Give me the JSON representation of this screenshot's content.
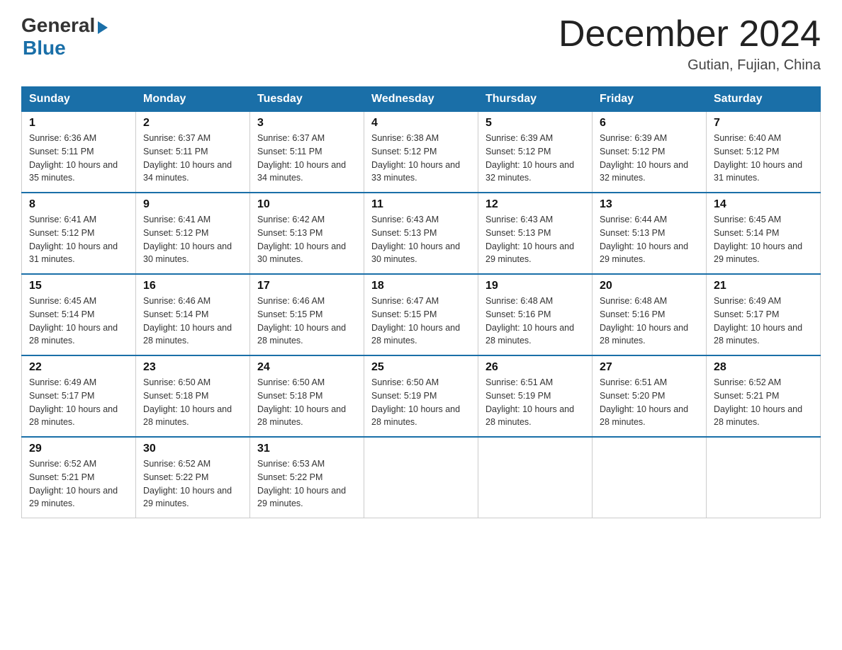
{
  "header": {
    "logo_general": "General",
    "logo_blue": "Blue",
    "month_title": "December 2024",
    "location": "Gutian, Fujian, China"
  },
  "days_of_week": [
    "Sunday",
    "Monday",
    "Tuesday",
    "Wednesday",
    "Thursday",
    "Friday",
    "Saturday"
  ],
  "weeks": [
    [
      {
        "day": "1",
        "sunrise": "6:36 AM",
        "sunset": "5:11 PM",
        "daylight": "10 hours and 35 minutes."
      },
      {
        "day": "2",
        "sunrise": "6:37 AM",
        "sunset": "5:11 PM",
        "daylight": "10 hours and 34 minutes."
      },
      {
        "day": "3",
        "sunrise": "6:37 AM",
        "sunset": "5:11 PM",
        "daylight": "10 hours and 34 minutes."
      },
      {
        "day": "4",
        "sunrise": "6:38 AM",
        "sunset": "5:12 PM",
        "daylight": "10 hours and 33 minutes."
      },
      {
        "day": "5",
        "sunrise": "6:39 AM",
        "sunset": "5:12 PM",
        "daylight": "10 hours and 32 minutes."
      },
      {
        "day": "6",
        "sunrise": "6:39 AM",
        "sunset": "5:12 PM",
        "daylight": "10 hours and 32 minutes."
      },
      {
        "day": "7",
        "sunrise": "6:40 AM",
        "sunset": "5:12 PM",
        "daylight": "10 hours and 31 minutes."
      }
    ],
    [
      {
        "day": "8",
        "sunrise": "6:41 AM",
        "sunset": "5:12 PM",
        "daylight": "10 hours and 31 minutes."
      },
      {
        "day": "9",
        "sunrise": "6:41 AM",
        "sunset": "5:12 PM",
        "daylight": "10 hours and 30 minutes."
      },
      {
        "day": "10",
        "sunrise": "6:42 AM",
        "sunset": "5:13 PM",
        "daylight": "10 hours and 30 minutes."
      },
      {
        "day": "11",
        "sunrise": "6:43 AM",
        "sunset": "5:13 PM",
        "daylight": "10 hours and 30 minutes."
      },
      {
        "day": "12",
        "sunrise": "6:43 AM",
        "sunset": "5:13 PM",
        "daylight": "10 hours and 29 minutes."
      },
      {
        "day": "13",
        "sunrise": "6:44 AM",
        "sunset": "5:13 PM",
        "daylight": "10 hours and 29 minutes."
      },
      {
        "day": "14",
        "sunrise": "6:45 AM",
        "sunset": "5:14 PM",
        "daylight": "10 hours and 29 minutes."
      }
    ],
    [
      {
        "day": "15",
        "sunrise": "6:45 AM",
        "sunset": "5:14 PM",
        "daylight": "10 hours and 28 minutes."
      },
      {
        "day": "16",
        "sunrise": "6:46 AM",
        "sunset": "5:14 PM",
        "daylight": "10 hours and 28 minutes."
      },
      {
        "day": "17",
        "sunrise": "6:46 AM",
        "sunset": "5:15 PM",
        "daylight": "10 hours and 28 minutes."
      },
      {
        "day": "18",
        "sunrise": "6:47 AM",
        "sunset": "5:15 PM",
        "daylight": "10 hours and 28 minutes."
      },
      {
        "day": "19",
        "sunrise": "6:48 AM",
        "sunset": "5:16 PM",
        "daylight": "10 hours and 28 minutes."
      },
      {
        "day": "20",
        "sunrise": "6:48 AM",
        "sunset": "5:16 PM",
        "daylight": "10 hours and 28 minutes."
      },
      {
        "day": "21",
        "sunrise": "6:49 AM",
        "sunset": "5:17 PM",
        "daylight": "10 hours and 28 minutes."
      }
    ],
    [
      {
        "day": "22",
        "sunrise": "6:49 AM",
        "sunset": "5:17 PM",
        "daylight": "10 hours and 28 minutes."
      },
      {
        "day": "23",
        "sunrise": "6:50 AM",
        "sunset": "5:18 PM",
        "daylight": "10 hours and 28 minutes."
      },
      {
        "day": "24",
        "sunrise": "6:50 AM",
        "sunset": "5:18 PM",
        "daylight": "10 hours and 28 minutes."
      },
      {
        "day": "25",
        "sunrise": "6:50 AM",
        "sunset": "5:19 PM",
        "daylight": "10 hours and 28 minutes."
      },
      {
        "day": "26",
        "sunrise": "6:51 AM",
        "sunset": "5:19 PM",
        "daylight": "10 hours and 28 minutes."
      },
      {
        "day": "27",
        "sunrise": "6:51 AM",
        "sunset": "5:20 PM",
        "daylight": "10 hours and 28 minutes."
      },
      {
        "day": "28",
        "sunrise": "6:52 AM",
        "sunset": "5:21 PM",
        "daylight": "10 hours and 28 minutes."
      }
    ],
    [
      {
        "day": "29",
        "sunrise": "6:52 AM",
        "sunset": "5:21 PM",
        "daylight": "10 hours and 29 minutes."
      },
      {
        "day": "30",
        "sunrise": "6:52 AM",
        "sunset": "5:22 PM",
        "daylight": "10 hours and 29 minutes."
      },
      {
        "day": "31",
        "sunrise": "6:53 AM",
        "sunset": "5:22 PM",
        "daylight": "10 hours and 29 minutes."
      },
      null,
      null,
      null,
      null
    ]
  ],
  "labels": {
    "sunrise_prefix": "Sunrise: ",
    "sunset_prefix": "Sunset: ",
    "daylight_prefix": "Daylight: "
  }
}
